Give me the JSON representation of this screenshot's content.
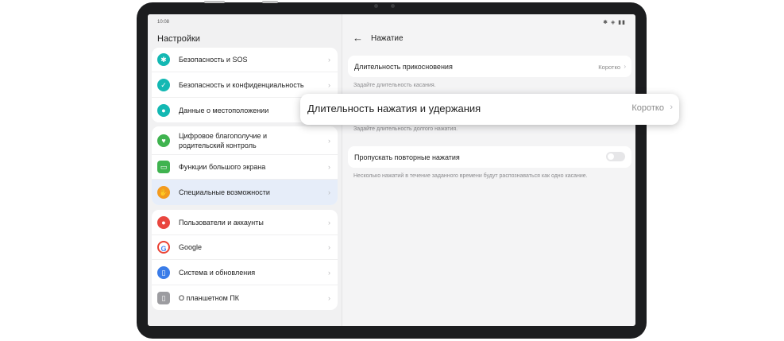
{
  "status_bar": {
    "time": "10:08",
    "icons": "✱ ◈ ▮▮"
  },
  "sidebar": {
    "title": "Настройки",
    "groups": [
      [
        {
          "label": "Безопасность и SOS",
          "icon": "sos-icon",
          "color": "#13b8b3",
          "glyph": "✱"
        },
        {
          "label": "Безопасность и конфиденциальность",
          "icon": "shield-icon",
          "color": "#13b8b3",
          "glyph": "✓"
        },
        {
          "label": "Данные о местоположении",
          "icon": "location-pin-icon",
          "color": "#13b8b3",
          "glyph": "●"
        }
      ],
      [
        {
          "label": "Цифровое благополучие и родительский контроль",
          "icon": "heart-icon",
          "color": "#3fb34f",
          "glyph": "♥"
        },
        {
          "label": "Функции большого экрана",
          "icon": "screen-icon",
          "color": "#3fb34f",
          "glyph": "▭"
        },
        {
          "label": "Специальные возможности",
          "icon": "hand-icon",
          "color": "#f39a1e",
          "glyph": "✋"
        }
      ],
      [
        {
          "label": "Пользователи и аккаунты",
          "icon": "user-icon",
          "color": "#e9463f",
          "glyph": "●"
        },
        {
          "label": "Google",
          "icon": "google-icon",
          "color": "#ffffff",
          "glyph": "G"
        },
        {
          "label": "Система и обновления",
          "icon": "system-update-icon",
          "color": "#3a7ce8",
          "glyph": "▯"
        },
        {
          "label": "О планшетном ПК",
          "icon": "tablet-info-icon",
          "color": "#9c9ca0",
          "glyph": "▯"
        }
      ]
    ]
  },
  "detail": {
    "title": "Нажатие",
    "touch_duration": {
      "label": "Длительность прикосновения",
      "value": "Коротко",
      "hint": "Задайте длительность касания."
    },
    "hold_duration": {
      "label": "Длительность нажатия и удержания",
      "value": "Коротко",
      "hint": "Задайте длительность долгого нажатия."
    },
    "ignore_repeat": {
      "label": "Пропускать повторные нажатия",
      "hint": "Несколько нажатий в течение заданного времени будут распознаваться как одно касание.",
      "enabled": false
    }
  },
  "chevron": "›",
  "back_arrow": "←"
}
